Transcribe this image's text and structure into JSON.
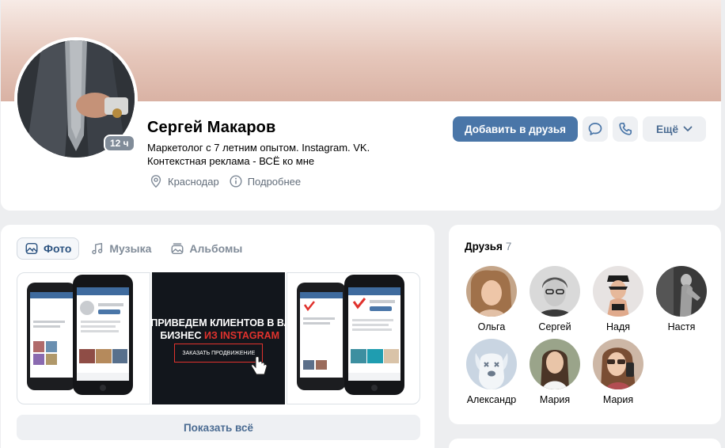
{
  "profile": {
    "name": "Сергей Макаров",
    "status": "Маркетолог с 7 летним опытом. Instagram. VK. Контекстная реклама - ВСЁ ко мне",
    "last_seen": "12 ч",
    "city": "Краснодар",
    "details_label": "Подробнее"
  },
  "actions": {
    "add_friend": "Добавить в друзья",
    "more": "Ещё"
  },
  "media": {
    "tabs": [
      {
        "label": "Фото",
        "active": true,
        "icon": "photo-icon"
      },
      {
        "label": "Музыка",
        "active": false,
        "icon": "music-icon"
      },
      {
        "label": "Альбомы",
        "active": false,
        "icon": "albums-icon"
      }
    ],
    "promo": {
      "line1": "ПРИВЕДЕМ КЛИЕНТОВ В ВАШ",
      "line2_prefix": "БИЗНЕС ",
      "line2_accent": "ИЗ INSTAGRAM",
      "button": "ЗАКАЗАТЬ ПРОДВИЖЕНИЕ"
    },
    "show_all": "Показать всё"
  },
  "friends": {
    "title": "Друзья",
    "count": "7",
    "items": [
      {
        "name": "Ольга",
        "avatar": "friend-photo"
      },
      {
        "name": "Сергей",
        "avatar": "friend-photo"
      },
      {
        "name": "Надя",
        "avatar": "friend-photo"
      },
      {
        "name": "Настя",
        "avatar": "friend-photo"
      },
      {
        "name": "Александр",
        "avatar": "vk-deactivated-dog-avatar"
      },
      {
        "name": "Мария",
        "avatar": "friend-photo"
      },
      {
        "name": "Мария",
        "avatar": "friend-photo"
      }
    ]
  },
  "colors": {
    "accent": "#4a76a8",
    "secondary_button_bg": "#eef0f3",
    "secondary_button_text": "#4a6b92",
    "promo_red": "#e0322d",
    "page_bg": "#edeef0"
  }
}
